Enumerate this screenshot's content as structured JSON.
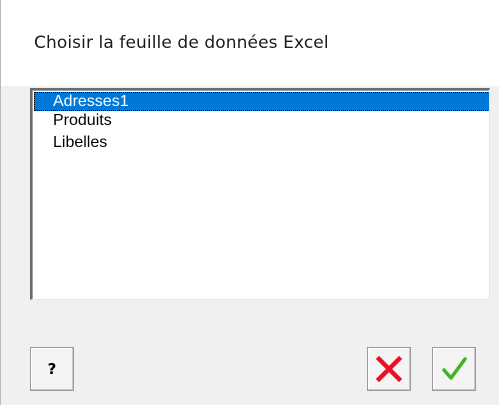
{
  "dialog": {
    "title": "Choisir la feuille de données Excel"
  },
  "sheet_list": {
    "items": [
      {
        "label": "Adresses1",
        "selected": true
      },
      {
        "label": "Produits",
        "selected": false
      },
      {
        "label": "Libelles",
        "selected": false
      }
    ]
  },
  "buttons": {
    "help": {
      "label": "?",
      "icon": "help-icon"
    },
    "cancel": {
      "icon": "red-x-icon",
      "color": "#e81123"
    },
    "ok": {
      "icon": "green-checkmark-icon",
      "color": "#3cb521"
    }
  },
  "colors": {
    "selection": "#0078d7",
    "background": "#f0f0f0"
  }
}
